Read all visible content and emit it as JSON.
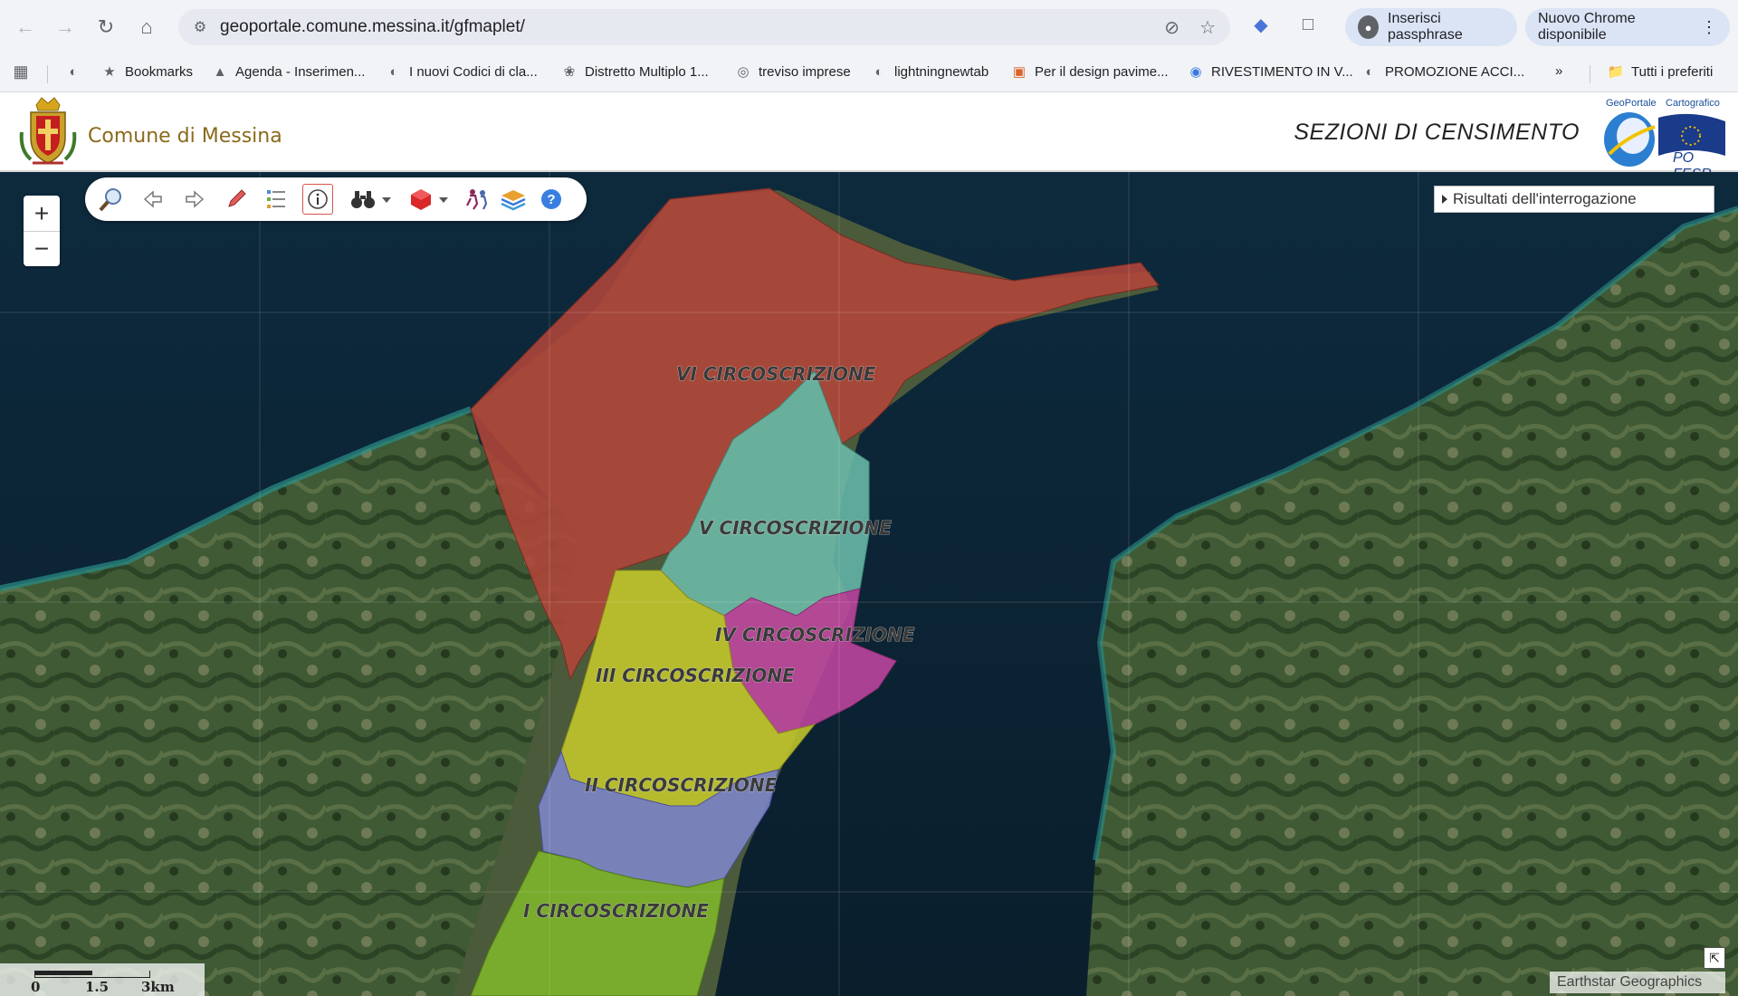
{
  "browser": {
    "url": "geoportale.comune.messina.it/gfmaplet/",
    "chip_passphrase": "Inserisci passphrase",
    "chip_update": "Nuovo Chrome disponibile",
    "bookmarks": [
      {
        "label": "Bookmarks",
        "icon": "star-icon"
      },
      {
        "label": "Agenda - Inserimen...",
        "icon": "agenda-icon"
      },
      {
        "label": "I nuovi Codici di cla...",
        "icon": "globe-icon"
      },
      {
        "label": "Distretto Multiplo 1...",
        "icon": "lions-icon"
      },
      {
        "label": "treviso imprese",
        "icon": "treviso-icon"
      },
      {
        "label": "lightningnewtab",
        "icon": "globe-icon"
      },
      {
        "label": "Per il design pavime...",
        "icon": "design-icon"
      },
      {
        "label": "RIVESTIMENTO IN V...",
        "icon": "chrome-icon"
      },
      {
        "label": "PROMOZIONE ACCI...",
        "icon": "globe-icon"
      }
    ],
    "all_bookmarks": "Tutti i preferiti"
  },
  "header": {
    "site_name": "Comune di Messina",
    "page_title": "SEZIONI DI CENSIMENTO",
    "logo_geoportale": "GeoPortale",
    "logo_cartografico": "Cartografico",
    "logo_po": "PO FESR"
  },
  "map": {
    "results_panel": "Risultati dell'interrogazione",
    "zoom_in": "+",
    "zoom_out": "−",
    "scale_labels": [
      "0",
      "1.5",
      "3km"
    ],
    "attribution": "Earthstar Geographics",
    "zones": [
      {
        "label": "VI CIRCOSCRIZIONE",
        "color": "#b2453a"
      },
      {
        "label": "V CIRCOSCRIZIONE",
        "color": "#6fbfae"
      },
      {
        "label": "IV CIRCOSCRIZIONE",
        "color": "#c245a0"
      },
      {
        "label": "III CIRCOSCRIZIONE",
        "color": "#c9cc2c"
      },
      {
        "label": "II CIRCOSCRIZIONE",
        "color": "#7f88c9"
      },
      {
        "label": "I CIRCOSCRIZIONE",
        "color": "#7fb62a"
      }
    ]
  }
}
